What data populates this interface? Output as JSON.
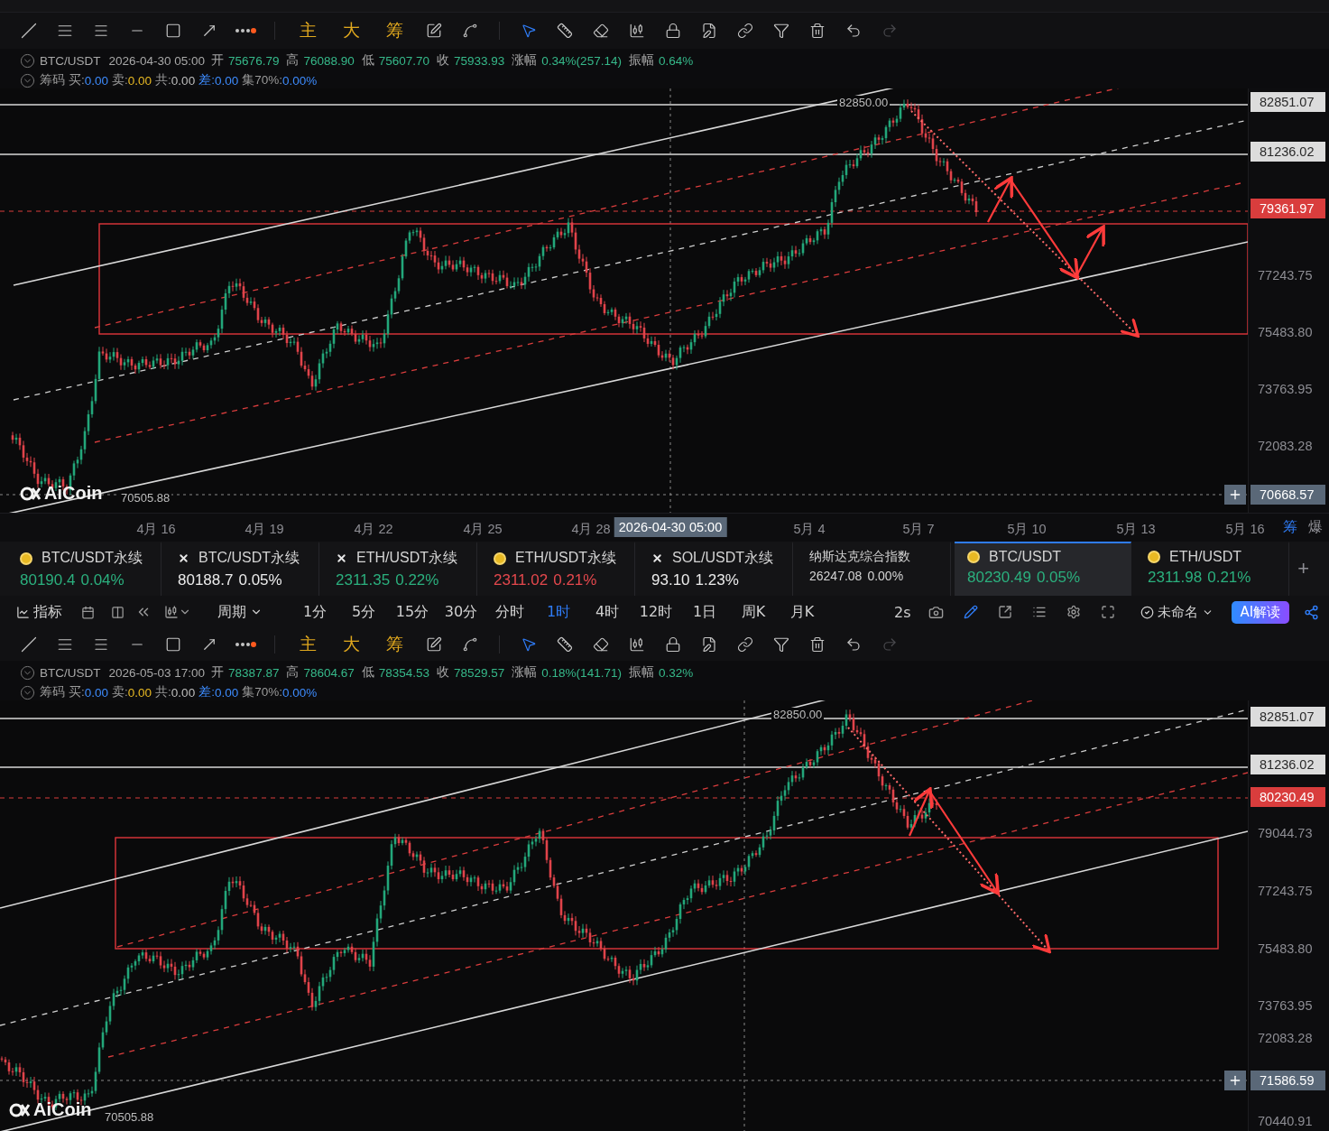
{
  "upper_panel": {
    "toolbar": {
      "tags": [
        "主",
        "大",
        "筹"
      ]
    },
    "info": {
      "symbol": "BTC/USDT",
      "time": "2026-04-30 05:00",
      "fields": [
        {
          "label": "开",
          "value": "75676.79"
        },
        {
          "label": "高",
          "value": "76088.90"
        },
        {
          "label": "低",
          "value": "75607.70"
        },
        {
          "label": "收",
          "value": "75933.93"
        },
        {
          "label": "涨幅",
          "value": "0.34%(257.14)"
        },
        {
          "label": "振幅",
          "value": "0.64%"
        }
      ]
    },
    "chips": {
      "title": "筹码",
      "items": [
        {
          "label": "买:",
          "value": "0.00",
          "color": "#3d8bfd"
        },
        {
          "label": "卖:",
          "value": "0.00",
          "color": "#e8b923"
        },
        {
          "label": "共:",
          "value": "0.00",
          "color": "#bdbdbd"
        },
        {
          "label": "差:",
          "value": "0.00",
          "color": "#3d8bfd"
        },
        {
          "label": "集70%:",
          "value": "0.00%",
          "color": "#3d8bfd"
        }
      ]
    },
    "chart": {
      "high_marker": "82850.00",
      "low_marker": "70505.88",
      "watermark": "AiCoin",
      "price_axis": [
        {
          "kind": "tag",
          "label": "82851.07"
        },
        {
          "kind": "tag",
          "label": "81236.02"
        },
        {
          "kind": "current",
          "label": "79361.97"
        },
        {
          "kind": "tick",
          "label": "77243.75"
        },
        {
          "kind": "tick",
          "label": "75483.80"
        },
        {
          "kind": "tick",
          "label": "73763.95"
        },
        {
          "kind": "tick",
          "label": "72083.28"
        },
        {
          "kind": "crosshair",
          "label": "70668.57"
        }
      ]
    },
    "x_axis": {
      "labels": [
        "4月 16",
        "4月 19",
        "4月 22",
        "4月 25",
        "4月 28",
        "5月 4",
        "5月 7",
        "5月 10",
        "5月 13",
        "5月 16"
      ],
      "crosshair": "2026-04-30 05:00",
      "buttons": [
        {
          "label": "筹",
          "selected": true
        },
        {
          "label": "爆",
          "selected": false
        }
      ]
    }
  },
  "tickers": [
    {
      "kind": "coin",
      "symbol": "BTC/USDT永续",
      "price": "80190.4",
      "change": "0.04%",
      "color": "#2bb07e",
      "selected": false
    },
    {
      "kind": "cross",
      "symbol": "BTC/USDT永续",
      "price": "80188.7",
      "change": "0.05%",
      "color": "#ececec",
      "selected": false
    },
    {
      "kind": "cross",
      "symbol": "ETH/USDT永续",
      "price": "2311.35",
      "change": "0.22%",
      "color": "#2bb07e",
      "selected": false
    },
    {
      "kind": "coin",
      "symbol": "ETH/USDT永续",
      "price": "2311.02",
      "change": "0.21%",
      "color": "#e5484d",
      "selected": false
    },
    {
      "kind": "cross",
      "symbol": "SOL/USDT永续",
      "price": "93.10",
      "change": "1.23%",
      "color": "#ececec",
      "selected": false
    },
    {
      "kind": "index",
      "symbol": "纳斯达克综合指数",
      "price": "26247.08",
      "change": "0.00%",
      "color": "#d4d4d4",
      "selected": false
    },
    {
      "kind": "coin",
      "symbol": "BTC/USDT",
      "price": "80230.49",
      "change": "0.05%",
      "color": "#2bb07e",
      "selected": true
    },
    {
      "kind": "coin",
      "symbol": "ETH/USDT",
      "price": "2311.98",
      "change": "0.21%",
      "color": "#2bb07e",
      "selected": false
    }
  ],
  "add_tab": "+",
  "period_bar": {
    "indicator": "指标",
    "period_menu": "周期",
    "periods": [
      {
        "label": "1分",
        "selected": false
      },
      {
        "label": "5分",
        "selected": false
      },
      {
        "label": "15分",
        "selected": false
      },
      {
        "label": "30分",
        "selected": false
      },
      {
        "label": "分时",
        "selected": false
      },
      {
        "label": "1时",
        "selected": true
      },
      {
        "label": "4时",
        "selected": false
      },
      {
        "label": "12时",
        "selected": false
      },
      {
        "label": "1日",
        "selected": false
      },
      {
        "label": "周K",
        "selected": false
      },
      {
        "label": "月K",
        "selected": false
      }
    ],
    "refresh": "2s",
    "layout_name": "未命名",
    "ai_button": "AI解读"
  },
  "lower_panel": {
    "toolbar": {
      "tags": [
        "主",
        "大",
        "筹"
      ]
    },
    "info": {
      "symbol": "BTC/USDT",
      "time": "2026-05-03 17:00",
      "fields": [
        {
          "label": "开",
          "value": "78387.87"
        },
        {
          "label": "高",
          "value": "78604.67"
        },
        {
          "label": "低",
          "value": "78354.53"
        },
        {
          "label": "收",
          "value": "78529.57"
        },
        {
          "label": "涨幅",
          "value": "0.18%(141.71)"
        },
        {
          "label": "振幅",
          "value": "0.32%"
        }
      ]
    },
    "chips": {
      "title": "筹码",
      "items": [
        {
          "label": "买:",
          "value": "0.00",
          "color": "#3d8bfd"
        },
        {
          "label": "卖:",
          "value": "0.00",
          "color": "#e8b923"
        },
        {
          "label": "共:",
          "value": "0.00",
          "color": "#bdbdbd"
        },
        {
          "label": "差:",
          "value": "0.00",
          "color": "#3d8bfd"
        },
        {
          "label": "集70%:",
          "value": "0.00%",
          "color": "#3d8bfd"
        }
      ]
    },
    "chart": {
      "high_marker": "82850.00",
      "low_marker": "70505.88",
      "watermark": "AiCoin",
      "price_axis": [
        {
          "kind": "tag",
          "label": "82851.07"
        },
        {
          "kind": "tag",
          "label": "81236.02"
        },
        {
          "kind": "current",
          "label": "80230.49"
        },
        {
          "kind": "tick",
          "label": "79044.73"
        },
        {
          "kind": "tick",
          "label": "77243.75"
        },
        {
          "kind": "tick",
          "label": "75483.80"
        },
        {
          "kind": "tick",
          "label": "73763.95"
        },
        {
          "kind": "tick",
          "label": "72083.28"
        },
        {
          "kind": "crosshair",
          "label": "71586.59"
        },
        {
          "kind": "tick",
          "label": "70440.91"
        }
      ]
    }
  }
}
